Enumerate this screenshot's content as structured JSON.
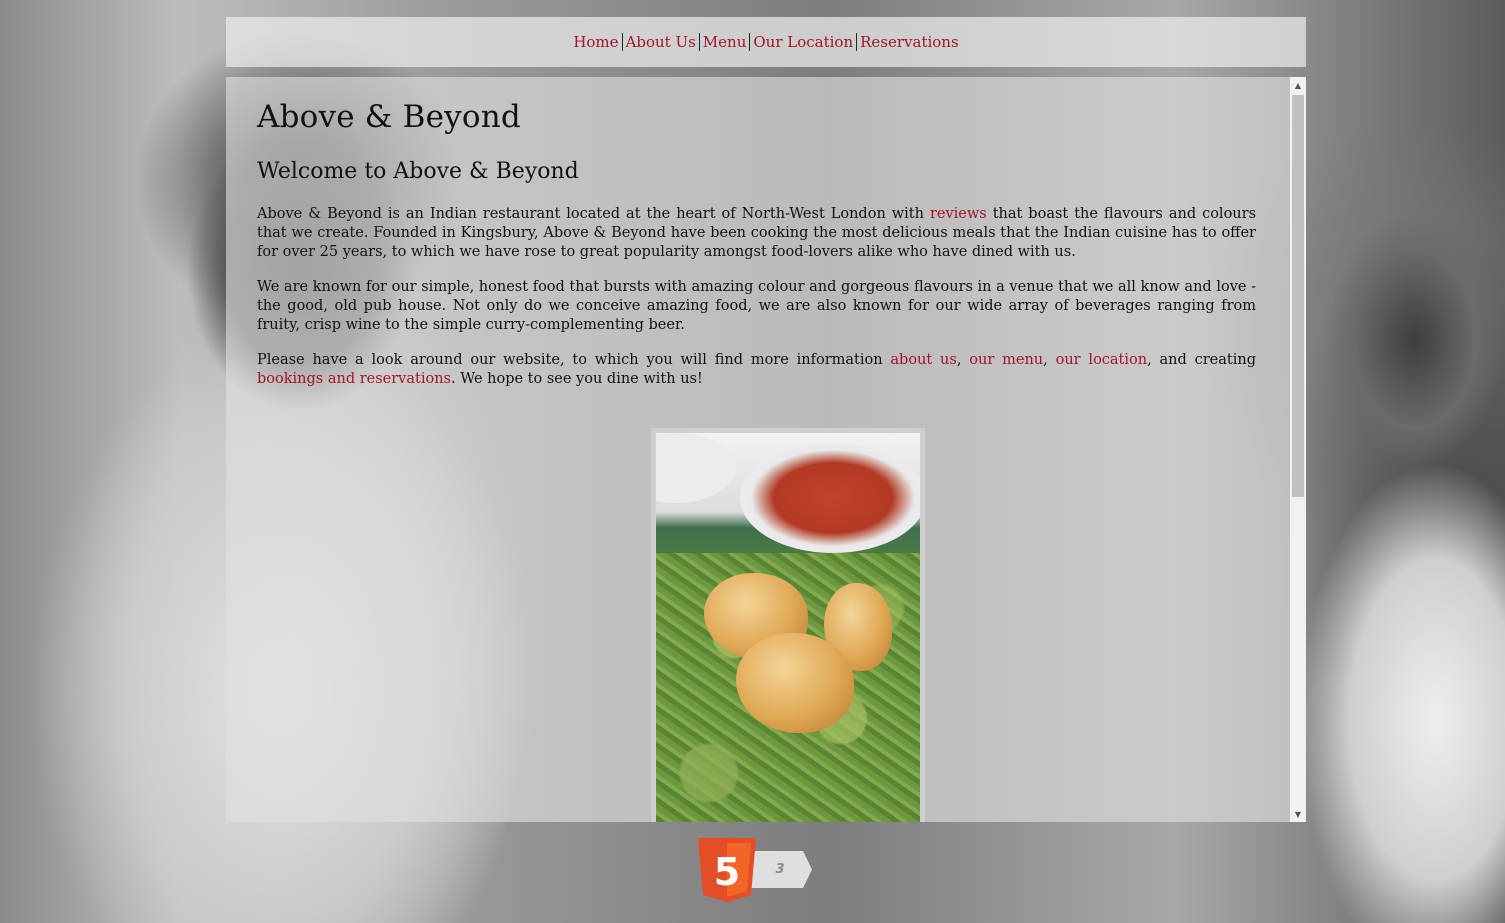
{
  "nav": {
    "items": [
      "Home",
      "About Us",
      "Menu",
      "Our Location",
      "Reservations"
    ]
  },
  "page": {
    "site_title": "Above & Beyond",
    "welcome_heading": "Welcome to Above & Beyond",
    "para1": {
      "before": "Above & Beyond is an Indian restaurant located at the heart of North-West London with ",
      "link": "reviews",
      "after": " that boast the flavours and colours that we create. Founded in Kingsbury, Above & Beyond have been cooking the most delicious meals that the Indian cuisine has to offer for over 25 years, to which we have rose to great popularity amongst food-lovers alike who have dined with us."
    },
    "para2": "We are known for our simple, honest food that bursts with amazing colour and gorgeous flavours in a venue that we all know and love - the good, old pub house. Not only do we conceive amazing food, we are also known for our wide array of beverages ranging from fruity, crisp wine to the simple curry-complementing beer.",
    "para3": {
      "before": "Please have a look around our website, to which you will find more information ",
      "link_about": "about us",
      "comma1": ", ",
      "link_menu": "our menu",
      "comma2": ", ",
      "link_location": "our location",
      "and_creating": ", and creating ",
      "link_bookings": "bookings and reservations",
      "after": ". We hope to see you dine with us!"
    }
  },
  "footer": {
    "badge_html_number": "5",
    "badge_css_number": "3"
  },
  "colors": {
    "link": "#a3132a",
    "html5_orange": "#e44d26",
    "html5_orange_light": "#f16529"
  },
  "icons": {
    "scroll_up": "▲",
    "scroll_down": "▼"
  }
}
